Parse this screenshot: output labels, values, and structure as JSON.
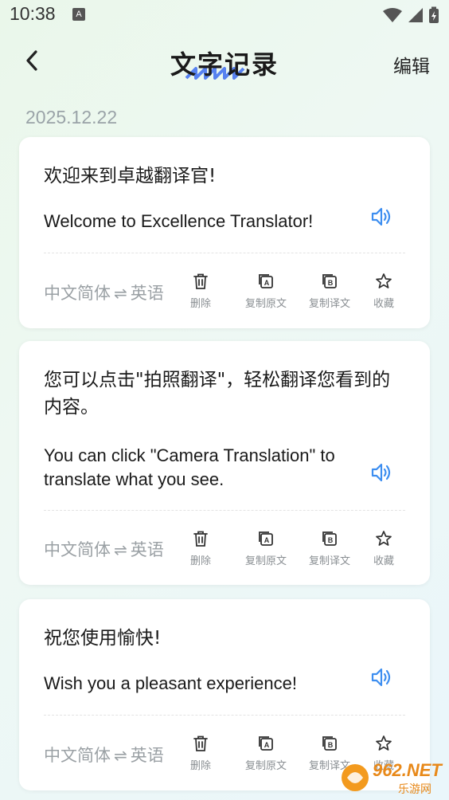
{
  "status": {
    "time": "10:38",
    "notif_glyph": "A"
  },
  "header": {
    "title": "文字记录",
    "edit_label": "编辑"
  },
  "date_label": "2025.12.22",
  "records": [
    {
      "source": "欢迎来到卓越翻译官!",
      "target": "Welcome to Excellence Translator!",
      "lang_from": "中文简体",
      "lang_arrow": "⇌",
      "lang_to": "英语"
    },
    {
      "source": "您可以点击\"拍照翻译\"，轻松翻译您看到的内容。",
      "target": "You can click \"Camera Translation\" to translate what you see.",
      "lang_from": "中文简体",
      "lang_arrow": "⇌",
      "lang_to": "英语"
    },
    {
      "source": "祝您使用愉快!",
      "target": "Wish you a pleasant experience!",
      "lang_from": "中文简体",
      "lang_arrow": "⇌",
      "lang_to": "英语"
    }
  ],
  "actions": {
    "delete": "删除",
    "copy_source": "复制原文",
    "copy_target": "复制译文",
    "favorite": "收藏"
  },
  "colors": {
    "accent": "#3d8ef0",
    "muted": "#9aa0a4",
    "title_squiggle": "#3d6df0"
  },
  "watermark": {
    "brand": "962.NET",
    "sub": "乐游网"
  }
}
